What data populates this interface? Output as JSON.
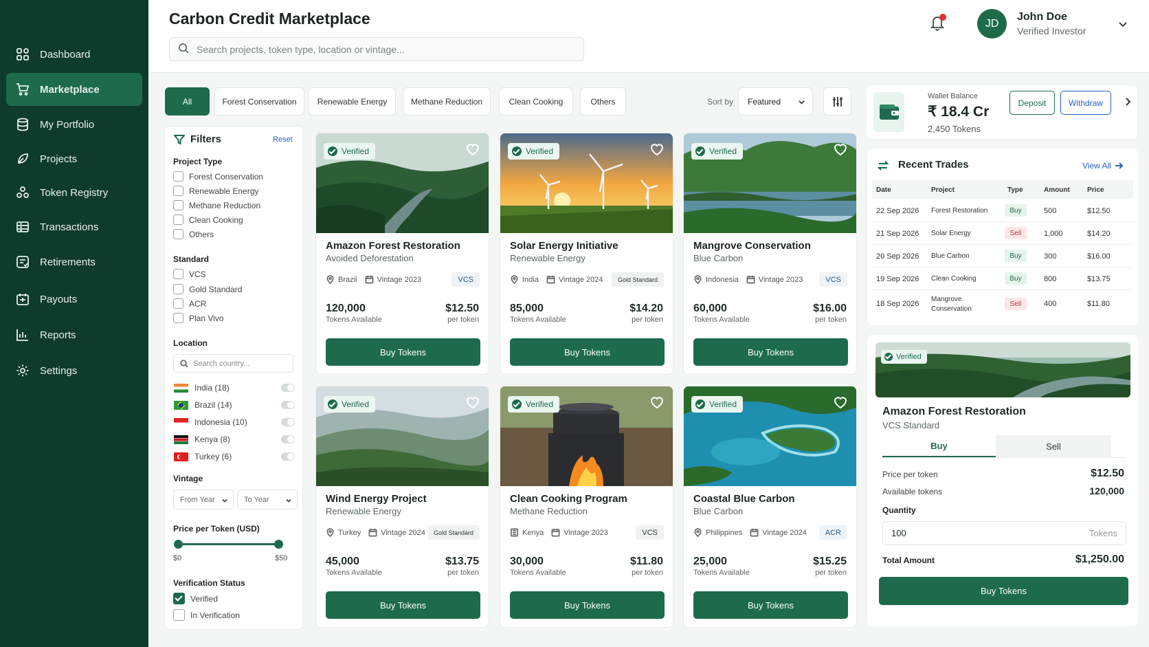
{
  "sidebar": {
    "items": [
      {
        "label": "Dashboard",
        "icon": "dashboard-icon"
      },
      {
        "label": "Marketplace",
        "icon": "cart-icon",
        "active": true
      },
      {
        "label": "My Portfolio",
        "icon": "database-icon"
      },
      {
        "label": "Projects",
        "icon": "leaf-icon"
      },
      {
        "label": "Token Registry",
        "icon": "registry-icon"
      },
      {
        "label": "Transactions",
        "icon": "transactions-icon"
      },
      {
        "label": "Retirements",
        "icon": "retirements-icon"
      },
      {
        "label": "Payouts",
        "icon": "payouts-icon"
      },
      {
        "label": "Reports",
        "icon": "reports-icon"
      },
      {
        "label": "Settings",
        "icon": "gear-icon"
      }
    ]
  },
  "header": {
    "title": "Carbon Credit Marketplace",
    "search_placeholder": "Search projects, token type, location or vintage...",
    "user": {
      "initials": "JD",
      "name": "John Doe",
      "role": "Verified Investor"
    }
  },
  "categories": [
    "All",
    "Forest Conservation",
    "Renewable Energy",
    "Methane Reduction",
    "Clean Cooking",
    "Others"
  ],
  "sort": {
    "label": "Sort by",
    "value": "Featured"
  },
  "filters": {
    "title": "Filters",
    "reset": "Reset",
    "project_type_label": "Project Type",
    "project_types": [
      "Forest Conservation",
      "Renewable Energy",
      "Methane Reduction",
      "Clean Cooking",
      "Others"
    ],
    "standard_label": "Standard",
    "standards": [
      "VCS",
      "Gold Standard",
      "ACR",
      "Plan Vivo"
    ],
    "location_label": "Location",
    "location_placeholder": "Search country...",
    "countries": [
      "India (18)",
      "Brazil (14)",
      "Indonesia (10)",
      "Kenya (8)",
      "Turkey (6)"
    ],
    "vintage_label": "Vintage",
    "from_year": "From Year",
    "to_year": "To Year",
    "price_label": "Price per Token (USD)",
    "price_min": "$0",
    "price_max": "$50",
    "verification_label": "Verification Status",
    "verification": [
      {
        "label": "Verified",
        "checked": true
      },
      {
        "label": "In Verification",
        "checked": false
      }
    ]
  },
  "cards": [
    {
      "badge": "Verified",
      "name": "Amazon Forest Restoration",
      "type": "Avoided Deforestation",
      "location": "Brazil",
      "vintage": "Vintage 2023",
      "standard": "VCS",
      "tokens": "120,000",
      "tokens_label": "Tokens Available",
      "price": "$12.50",
      "price_label": "per token",
      "button": "Buy Tokens"
    },
    {
      "badge": "Verified",
      "name": "Solar Energy Initiative",
      "type": "Renewable Energy",
      "location": "India",
      "vintage": "Vintage 2024",
      "standard": "Gold Standard",
      "tokens": "85,000",
      "tokens_label": "Tokens Available",
      "price": "$14.20",
      "price_label": "per token",
      "button": "Buy Tokens"
    },
    {
      "badge": "Verified",
      "name": "Mangrove Conservation",
      "type": "Blue Carbon",
      "location": "Indonesia",
      "vintage": "Vintage 2023",
      "standard": "VCS",
      "tokens": "60,000",
      "tokens_label": "Tokens Available",
      "price": "$16.00",
      "price_label": "per token",
      "button": "Buy Tokens"
    },
    {
      "badge": "Verified",
      "name": "Wind Energy Project",
      "type": "Renewable Energy",
      "location": "Turkey",
      "vintage": "Vintage 2024",
      "standard": "Gold Standard",
      "tokens": "45,000",
      "tokens_label": "Tokens Available",
      "price": "$13.75",
      "price_label": "per token",
      "button": "Buy Tokens"
    },
    {
      "badge": "Verified",
      "name": "Clean Cooking Program",
      "type": "Methane Reduction",
      "location": "Kenya",
      "vintage": "Vintage 2023",
      "standard": "VCS",
      "tokens": "30,000",
      "tokens_label": "Tokens Available",
      "price": "$11.80",
      "price_label": "per token",
      "button": "Buy Tokens"
    },
    {
      "badge": "Verified",
      "name": "Coastal Blue Carbon",
      "type": "Blue Carbon",
      "location": "Philippines",
      "vintage": "Vintage 2024",
      "standard": "ACR",
      "tokens": "25,000",
      "tokens_label": "Tokens Available",
      "price": "$15.25",
      "price_label": "per token",
      "button": "Buy Tokens"
    }
  ],
  "wallet": {
    "label": "Wallet Balance",
    "amount": "₹ 18.4 Cr",
    "tokens": "2,450 Tokens",
    "deposit": "Deposit",
    "withdraw": "Withdraw"
  },
  "trades": {
    "title": "Recent Trades",
    "view_all": "View All",
    "headers": [
      "Date",
      "Project",
      "Type",
      "Amount",
      "Price"
    ],
    "rows": [
      {
        "date": "22 Sep 2026",
        "project": "Forest Restoration",
        "type": "Buy",
        "amount": "500",
        "price": "$12.50"
      },
      {
        "date": "21 Sep 2026",
        "project": "Solar Energy",
        "type": "Sell",
        "amount": "1,000",
        "price": "$14.20"
      },
      {
        "date": "20 Sep 2026",
        "project": "Blue Carbon",
        "type": "Buy",
        "amount": "300",
        "price": "$16.00"
      },
      {
        "date": "19 Sep 2026",
        "project": "Clean Cooking",
        "type": "Buy",
        "amount": "800",
        "price": "$13.75"
      },
      {
        "date": "18 Sep 2026",
        "project": "Mangrove Conservation",
        "type": "Sell",
        "amount": "400",
        "price": "$11.80"
      }
    ]
  },
  "detail": {
    "badge": "Verified",
    "name": "Amazon Forest Restoration",
    "standard": "VCS Standard",
    "tab_buy": "Buy",
    "tab_sell": "Sell",
    "price_label": "Price per token",
    "price": "$12.50",
    "available_label": "Available tokens",
    "available": "120,000",
    "quantity_label": "Quantity",
    "quantity": "100",
    "quantity_unit": "Tokens",
    "total_label": "Total Amount",
    "total": "$1,250.00",
    "button": "Buy Tokens"
  },
  "colors": {
    "sidebar": "#0f3b2c",
    "accent": "#1d6b4c",
    "active_nav": "#1d6b4c",
    "link": "#2463b8",
    "sell": "#c0392b"
  }
}
